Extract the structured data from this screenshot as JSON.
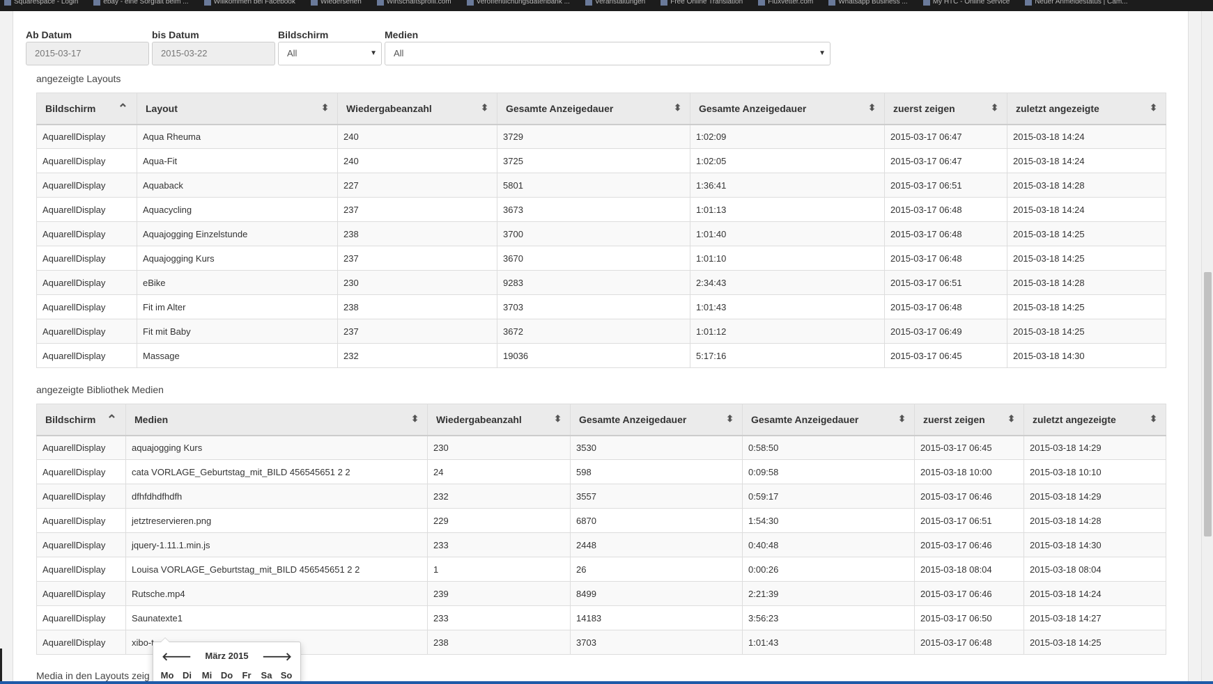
{
  "bookmarks": [
    "Squarespace - Login",
    "ebay - eine Sorgfalt beim ...",
    "Willkommen bei Facebook",
    "Wiedersehen",
    "Wirtschaftsprofil.com",
    "Veröffentlichungsdatenbank ...",
    "Veranstaltungen",
    "Free Online Translation",
    "Fluxvetter.com",
    "Whatsapp Business ...",
    "My HTC - Online Service",
    "Neuer Anmeldestatus | Cam..."
  ],
  "filters": {
    "from_label": "Ab Datum",
    "from_value": "2015-03-17",
    "to_label": "bis Datum",
    "to_value": "2015-03-22",
    "display_label": "Bildschirm",
    "display_value": "All",
    "media_label": "Medien",
    "media_value": "All"
  },
  "layouts": {
    "title": "angezeigte Layouts",
    "headers": [
      "Bildschirm",
      "Layout",
      "Wiedergabeanzahl",
      "Gesamte Anzeigedauer",
      "Gesamte Anzeigedauer",
      "zuerst zeigen",
      "zuletzt angezeigte"
    ],
    "rows": [
      [
        "AquarellDisplay",
        "Aqua Rheuma",
        "240",
        "3729",
        "1:02:09",
        "2015-03-17 06:47",
        "2015-03-18 14:24"
      ],
      [
        "AquarellDisplay",
        "Aqua-Fit",
        "240",
        "3725",
        "1:02:05",
        "2015-03-17 06:47",
        "2015-03-18 14:24"
      ],
      [
        "AquarellDisplay",
        "Aquaback",
        "227",
        "5801",
        "1:36:41",
        "2015-03-17 06:51",
        "2015-03-18 14:28"
      ],
      [
        "AquarellDisplay",
        "Aquacycling",
        "237",
        "3673",
        "1:01:13",
        "2015-03-17 06:48",
        "2015-03-18 14:24"
      ],
      [
        "AquarellDisplay",
        "Aquajogging Einzelstunde",
        "238",
        "3700",
        "1:01:40",
        "2015-03-17 06:48",
        "2015-03-18 14:25"
      ],
      [
        "AquarellDisplay",
        "Aquajogging Kurs",
        "237",
        "3670",
        "1:01:10",
        "2015-03-17 06:48",
        "2015-03-18 14:25"
      ],
      [
        "AquarellDisplay",
        "eBike",
        "230",
        "9283",
        "2:34:43",
        "2015-03-17 06:51",
        "2015-03-18 14:28"
      ],
      [
        "AquarellDisplay",
        "Fit im Alter",
        "238",
        "3703",
        "1:01:43",
        "2015-03-17 06:48",
        "2015-03-18 14:25"
      ],
      [
        "AquarellDisplay",
        "Fit mit Baby",
        "237",
        "3672",
        "1:01:12",
        "2015-03-17 06:49",
        "2015-03-18 14:25"
      ],
      [
        "AquarellDisplay",
        "Massage",
        "232",
        "19036",
        "5:17:16",
        "2015-03-17 06:45",
        "2015-03-18 14:30"
      ]
    ]
  },
  "media": {
    "title": "angezeigte Bibliothek Medien",
    "headers": [
      "Bildschirm",
      "Medien",
      "Wiedergabeanzahl",
      "Gesamte Anzeigedauer",
      "Gesamte Anzeigedauer",
      "zuerst zeigen",
      "zuletzt angezeigte"
    ],
    "rows": [
      [
        "AquarellDisplay",
        "aquajogging Kurs",
        "230",
        "3530",
        "0:58:50",
        "2015-03-17 06:45",
        "2015-03-18 14:29"
      ],
      [
        "AquarellDisplay",
        "cata VORLAGE_Geburtstag_mit_BILD 456545651 2 2",
        "24",
        "598",
        "0:09:58",
        "2015-03-18 10:00",
        "2015-03-18 10:10"
      ],
      [
        "AquarellDisplay",
        "dfhfdhdfhdfh",
        "232",
        "3557",
        "0:59:17",
        "2015-03-17 06:46",
        "2015-03-18 14:29"
      ],
      [
        "AquarellDisplay",
        "jetztreservieren.png",
        "229",
        "6870",
        "1:54:30",
        "2015-03-17 06:51",
        "2015-03-18 14:28"
      ],
      [
        "AquarellDisplay",
        "jquery-1.11.1.min.js",
        "233",
        "2448",
        "0:40:48",
        "2015-03-17 06:46",
        "2015-03-18 14:30"
      ],
      [
        "AquarellDisplay",
        "Louisa VORLAGE_Geburtstag_mit_BILD 456545651 2 2",
        "1",
        "26",
        "0:00:26",
        "2015-03-18 08:04",
        "2015-03-18 08:04"
      ],
      [
        "AquarellDisplay",
        "Rutsche.mp4",
        "239",
        "8499",
        "2:21:39",
        "2015-03-17 06:46",
        "2015-03-18 14:24"
      ],
      [
        "AquarellDisplay",
        "Saunatexte1",
        "233",
        "14183",
        "3:56:23",
        "2015-03-17 06:50",
        "2015-03-18 14:27"
      ],
      [
        "AquarellDisplay",
        "xibo-t",
        "238",
        "3703",
        "1:01:43",
        "2015-03-17 06:48",
        "2015-03-18 14:25"
      ]
    ]
  },
  "third_section_title": "Media in den Layouts zeig",
  "datepicker": {
    "prev": "🡐",
    "next": "🡒",
    "title": "März 2015",
    "days": [
      "Mo",
      "Di",
      "Mi",
      "Do",
      "Fr",
      "Sa",
      "So"
    ]
  }
}
